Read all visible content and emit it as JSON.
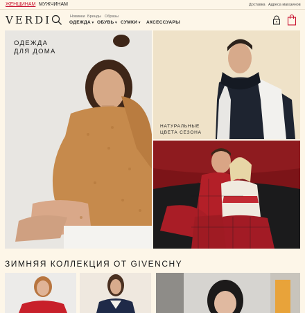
{
  "topbar": {
    "women": "ЖЕНЩИНАМ",
    "men": "МУЖЧИНАМ",
    "delivery": "Доставка",
    "stores": "Адреса магазинов"
  },
  "header": {
    "logo": "VERDI",
    "subnav": [
      "Новинки",
      "Бренды",
      "Образы"
    ],
    "nav": [
      "ОДЕЖДА",
      "ОБУВЬ",
      "СУМКИ",
      "АКСЕССУАРЫ"
    ]
  },
  "hero": {
    "left_caption_1": "ОДЕЖДА",
    "left_caption_2": "ДЛЯ ДОМА",
    "right_caption_1": "НАТУРАЛЬНЫЕ",
    "right_caption_2": "ЦВЕТА СЕЗОНА"
  },
  "section": {
    "title": "ЗИМНЯЯ КОЛЛЕКЦИЯ ОТ GIVENCHY"
  },
  "colors": {
    "background": "#fdf6e8",
    "accent": "#c8102e"
  }
}
